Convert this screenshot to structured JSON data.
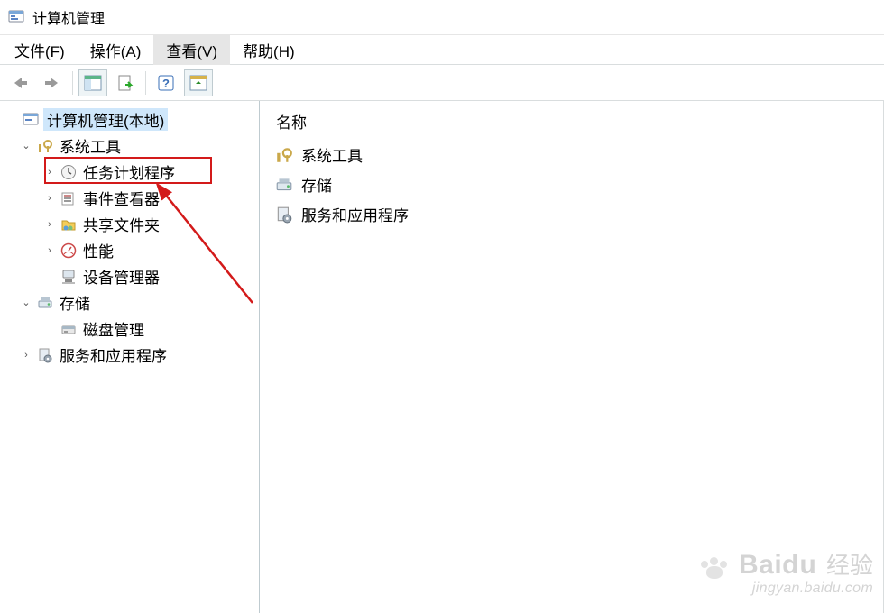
{
  "window": {
    "title": "计算机管理"
  },
  "menu": {
    "file": "文件(F)",
    "action": "操作(A)",
    "view": "查看(V)",
    "help": "帮助(H)"
  },
  "tree": {
    "root": "计算机管理(本地)",
    "system_tools": "系统工具",
    "task_scheduler": "任务计划程序",
    "event_viewer": "事件查看器",
    "shared_folders": "共享文件夹",
    "performance": "性能",
    "device_manager": "设备管理器",
    "storage": "存储",
    "disk_management": "磁盘管理",
    "services_apps": "服务和应用程序"
  },
  "list": {
    "header": "名称",
    "items": {
      "system_tools": "系统工具",
      "storage": "存储",
      "services_apps": "服务和应用程序"
    }
  },
  "watermark": {
    "brand": "Bai",
    "brand2": "du",
    "cn": "经验",
    "url": "jingyan.baidu.com"
  }
}
